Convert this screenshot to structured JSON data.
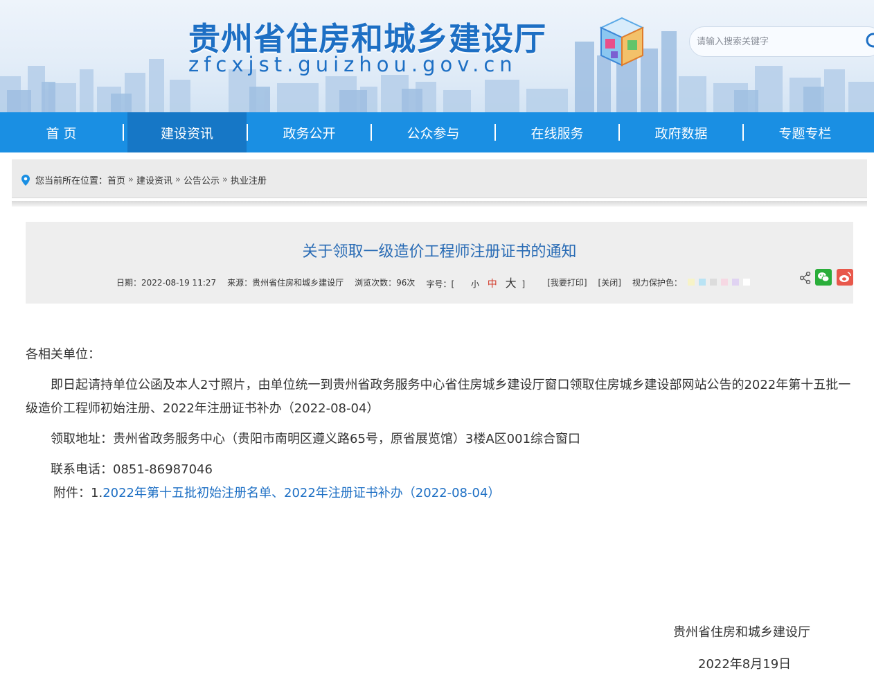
{
  "header": {
    "site_title": "贵州省住房和城乡建设厅",
    "site_domain": "zfcxjst.guizhou.gov.cn",
    "search_placeholder": "请输入搜索关键字"
  },
  "nav": {
    "items": [
      {
        "label": "首 页"
      },
      {
        "label": "建设资讯"
      },
      {
        "label": "政务公开"
      },
      {
        "label": "公众参与"
      },
      {
        "label": "在线服务"
      },
      {
        "label": "政府数据"
      },
      {
        "label": "专题专栏"
      }
    ],
    "active_index": 1
  },
  "breadcrumb": {
    "prefix": "您当前所在位置：",
    "items": [
      "首页",
      "建设资讯",
      "公告公示",
      "执业注册"
    ],
    "separator": "»"
  },
  "article": {
    "title": "关于领取一级造价工程师注册证书的通知",
    "meta": {
      "date": "日期：2022-08-19 11:27",
      "source": "来源：贵州省住房和城乡建设厅",
      "views": "浏览次数：96次",
      "font_size_label": "字号：[",
      "font_small": "小",
      "font_mid": "中",
      "font_big": "大",
      "font_close": "]",
      "print": "[我要打印]",
      "close": "[关闭]",
      "eye_care_label": "视力保护色："
    },
    "eye_care_colors": [
      "#f7f3c7",
      "#b9e3f4",
      "#dcdcdc",
      "#f6d8e3",
      "#e0d3f2",
      "#ffffff"
    ],
    "salutation": "各相关单位：",
    "para1": "即日起请持单位公函及本人2寸照片，由单位统一到贵州省政务服务中心省住房城乡建设厅窗口领取住房城乡建设部网站公告的2022年第十五批一级造价工程师初始注册、2022年注册证书补办（2022-08-04）",
    "address": "领取地址：贵州省政务服务中心（贵阳市南明区遵义路65号，原省展览馆）3楼A区001综合窗口",
    "phone": "联系电话：0851-86987046",
    "attachment_label": "附件：1.",
    "attachment_link": "2022年第十五批初始注册名单、2022年注册证书补办（2022-08-04）",
    "sign_org": "贵州省住房和城乡建设厅",
    "sign_date": "2022年8月19日"
  },
  "colors": {
    "nav_bg": "#1a8fe3",
    "nav_active": "#1677c6",
    "title_blue": "#2a6cb5",
    "link_blue": "#1d6fc4"
  }
}
